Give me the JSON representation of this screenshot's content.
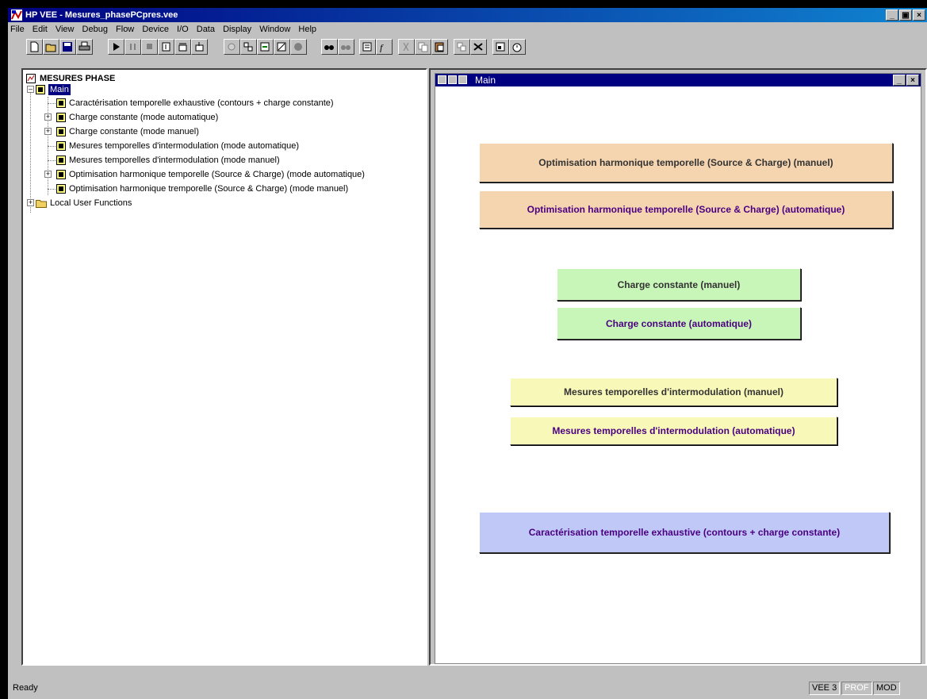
{
  "window": {
    "title": "HP VEE - Mesures_phasePCpres.vee",
    "controls": [
      "minimize-icon",
      "restore-icon",
      "close-icon"
    ]
  },
  "menu": [
    "File",
    "Edit",
    "View",
    "Debug",
    "Flow",
    "Device",
    "I/O",
    "Data",
    "Display",
    "Window",
    "Help"
  ],
  "toolbar_icons": [
    "new-icon",
    "open-icon",
    "save-icon",
    "print-icon",
    "run-icon",
    "pause-icon",
    "stop-icon",
    "step-into-icon",
    "step-over-icon",
    "step-out-icon",
    "hand-icon",
    "clean-up-icon",
    "move-icon",
    "zoom-icon",
    "globe-icon",
    "find-icon",
    "find-again-icon",
    "properties-icon",
    "function-icon",
    "cut-icon",
    "copy-icon",
    "paste-icon",
    "clone-icon",
    "delete-icon",
    "panel-view-icon",
    "timer-icon"
  ],
  "tree": {
    "root": "MESURES PHASE",
    "main": "Main",
    "children": [
      "Caractérisation temporelle exhaustive (contours + charge constante)",
      "Charge constante (mode automatique)",
      "Charge constante (mode manuel)",
      "Mesures temporelles d'intermodulation (mode automatique)",
      "Mesures temporelles d'intermodulation (mode manuel)",
      "Optimisation harmonique temporelle (Source & Charge) (mode automatique)",
      "Optimisation harmonique tremporelle (Source & Charge) (mode manuel)"
    ],
    "local": "Local User Functions"
  },
  "main_window": {
    "title": "Main",
    "buttons": [
      {
        "label": "Optimisation harmonique temporelle (Source & Charge) (manuel)",
        "bg": "#f5d5b0",
        "fg": "#333333"
      },
      {
        "label": "Optimisation harmonique temporelle (Source & Charge) (automatique)",
        "bg": "#f5d5b0",
        "fg": "#4b0082"
      },
      {
        "label": "Charge constante (manuel)",
        "bg": "#c8f5b8",
        "fg": "#333333"
      },
      {
        "label": "Charge constante (automatique)",
        "bg": "#c8f5b8",
        "fg": "#4b0082"
      },
      {
        "label": "Mesures temporelles d'intermodulation (manuel)",
        "bg": "#f8f8b8",
        "fg": "#333333"
      },
      {
        "label": "Mesures temporelles d'intermodulation (automatique)",
        "bg": "#f8f8b8",
        "fg": "#4b0082"
      },
      {
        "label": "Caractérisation temporelle exhaustive (contours + charge constante)",
        "bg": "#c0c8f8",
        "fg": "#4b0082"
      }
    ]
  },
  "status": {
    "text": "Ready",
    "cells": [
      "VEE 3",
      "PROF",
      "MOD"
    ]
  }
}
